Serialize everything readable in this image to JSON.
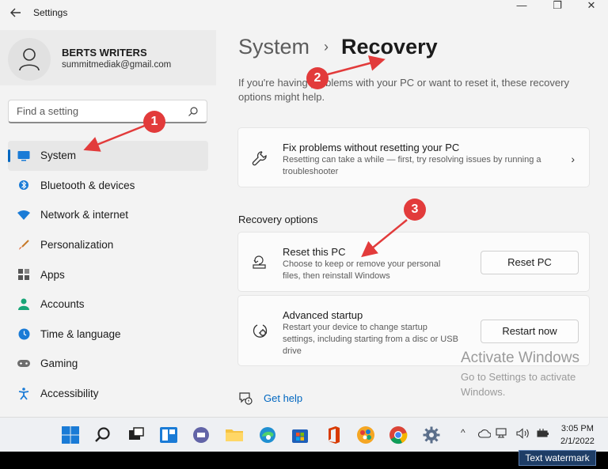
{
  "window": {
    "title": "Settings",
    "back_icon": "arrow-left-icon",
    "min_glyph": "—",
    "max_glyph": "❐",
    "close_glyph": "✕"
  },
  "account": {
    "name": "BERTS WRITERS",
    "email": "summitmediak@gmail.com"
  },
  "search": {
    "placeholder": "Find a setting"
  },
  "sidebar": {
    "items": [
      {
        "label": "System",
        "icon": "monitor-icon",
        "active": true
      },
      {
        "label": "Bluetooth & devices",
        "icon": "bluetooth-icon"
      },
      {
        "label": "Network & internet",
        "icon": "wifi-icon"
      },
      {
        "label": "Personalization",
        "icon": "brush-icon"
      },
      {
        "label": "Apps",
        "icon": "apps-icon"
      },
      {
        "label": "Accounts",
        "icon": "person-icon"
      },
      {
        "label": "Time & language",
        "icon": "globe-clock-icon"
      },
      {
        "label": "Gaming",
        "icon": "gamepad-icon"
      },
      {
        "label": "Accessibility",
        "icon": "accessibility-icon"
      }
    ]
  },
  "main": {
    "breadcrumb": {
      "parent": "System",
      "separator": "›",
      "current": "Recovery"
    },
    "intro": "If you're having problems with your PC or want to reset it, these recovery options might help.",
    "fix": {
      "title": "Fix problems without resetting your PC",
      "desc": "Resetting can take a while — first, try resolving issues by running a troubleshooter",
      "chevron": "›"
    },
    "section_title": "Recovery options",
    "reset": {
      "title": "Reset this PC",
      "desc": "Choose to keep or remove your personal files, then reinstall Windows",
      "button": "Reset PC"
    },
    "advanced": {
      "title": "Advanced startup",
      "desc": "Restart your device to change startup settings, including starting from a disc or USB drive",
      "button": "Restart now"
    },
    "get_help": "Get help"
  },
  "activation": {
    "title": "Activate Windows",
    "body": "Go to Settings to activate Windows."
  },
  "annotations": {
    "badge1": "1",
    "badge2": "2",
    "badge3": "3",
    "color": "#e23b3b"
  },
  "taskbar": {
    "time": "3:05 PM",
    "date": "2/1/2022",
    "chevron_up": "^"
  },
  "watermark_button": "Text watermark",
  "colors": {
    "accent": "#0067c0",
    "background": "#f3f3f3",
    "card": "#fbfbfb"
  }
}
